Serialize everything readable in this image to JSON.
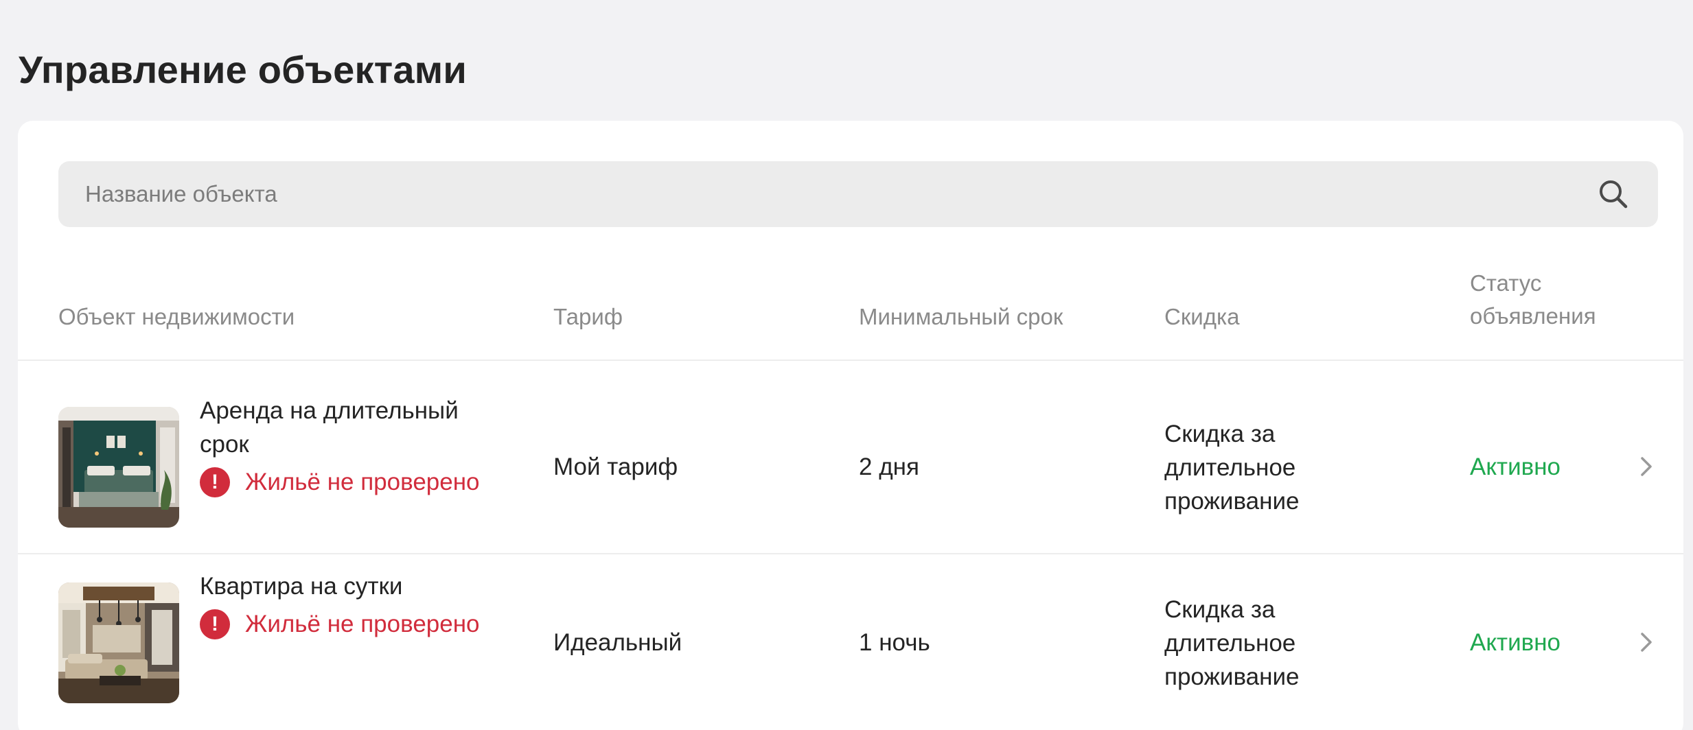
{
  "page": {
    "title": "Управление объектами"
  },
  "search": {
    "placeholder": "Название объекта",
    "icon": "search-icon"
  },
  "table": {
    "headers": {
      "object": "Объект недвижимости",
      "tariff": "Тариф",
      "min_term": "Минимальный срок",
      "discount": "Скидка",
      "status_line1": "Статус",
      "status_line2": "объявления"
    },
    "rows": [
      {
        "title_line1": "Аренда на длительный",
        "title_line2": "срок",
        "warning": "Жильё не проверено",
        "tariff": "Мой тариф",
        "min_term": "2 дня",
        "discount_line1": "Скидка за",
        "discount_line2": "длительное",
        "discount_line3": "проживание",
        "status": "Активно"
      },
      {
        "title_line1": "Квартира на сутки",
        "warning": "Жильё не проверено",
        "tariff": "Идеальный",
        "min_term": "1 ночь",
        "discount_line1": "Скидка за",
        "discount_line2": "длительное",
        "discount_line3": "проживание",
        "status": "Активно"
      }
    ]
  },
  "colors": {
    "background": "#f2f2f4",
    "card": "#ffffff",
    "warning": "#d12c3c",
    "active_status": "#1fa84f",
    "muted_text": "#8a8a8a",
    "text": "#242424"
  }
}
